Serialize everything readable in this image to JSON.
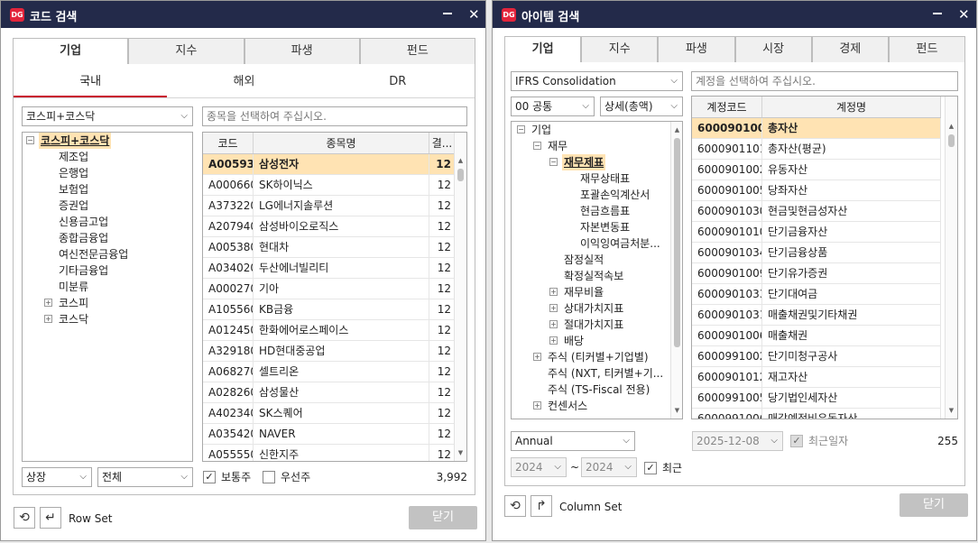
{
  "left": {
    "logo": "DG",
    "title": "코드 검색",
    "tabs": [
      "기업",
      "지수",
      "파생",
      "펀드"
    ],
    "subtabs": [
      "국내",
      "해외",
      "DR"
    ],
    "market_combo": "코스피+코스닥",
    "search_placeholder": "종목을 선택하여 주십시오.",
    "tree": [
      {
        "label": "코스피+코스닥",
        "expander": "−",
        "level": 0,
        "selected": true
      },
      {
        "label": "제조업",
        "level": 1
      },
      {
        "label": "은행업",
        "level": 1
      },
      {
        "label": "보험업",
        "level": 1
      },
      {
        "label": "증권업",
        "level": 1
      },
      {
        "label": "신용금고업",
        "level": 1
      },
      {
        "label": "종합금융업",
        "level": 1
      },
      {
        "label": "여신전문금융업",
        "level": 1
      },
      {
        "label": "기타금융업",
        "level": 1
      },
      {
        "label": "미분류",
        "level": 1
      },
      {
        "label": "코스피",
        "expander": "+",
        "level": 1
      },
      {
        "label": "코스닥",
        "expander": "+",
        "level": 1
      }
    ],
    "grid_headers": [
      "코드",
      "종목명",
      "결..."
    ],
    "rows": [
      [
        "A005930",
        "삼성전자",
        "12"
      ],
      [
        "A000660",
        "SK하이닉스",
        "12"
      ],
      [
        "A373220",
        "LG에너지솔루션",
        "12"
      ],
      [
        "A207940",
        "삼성바이오로직스",
        "12"
      ],
      [
        "A005380",
        "현대차",
        "12"
      ],
      [
        "A034020",
        "두산에너빌리티",
        "12"
      ],
      [
        "A000270",
        "기아",
        "12"
      ],
      [
        "A105560",
        "KB금융",
        "12"
      ],
      [
        "A012450",
        "한화에어로스페이스",
        "12"
      ],
      [
        "A329180",
        "HD현대중공업",
        "12"
      ],
      [
        "A068270",
        "셀트리온",
        "12"
      ],
      [
        "A028260",
        "삼성물산",
        "12"
      ],
      [
        "A402340",
        "SK스퀘어",
        "12"
      ],
      [
        "A035420",
        "NAVER",
        "12"
      ],
      [
        "A055550",
        "신한지주",
        "12"
      ]
    ],
    "status_combo": "상장",
    "all_combo": "전체",
    "common_label": "보통주",
    "preferred_label": "우선주",
    "count": "3,992",
    "row_set_label": "Row Set",
    "close_label": "닫기"
  },
  "right": {
    "logo": "DG",
    "title": "아이템 검색",
    "tabs": [
      "기업",
      "지수",
      "파생",
      "시장",
      "경제",
      "펀드"
    ],
    "consolidation_combo": "IFRS Consolidation",
    "account_placeholder": "계정을 선택하여 주십시오.",
    "common_combo": "00 공통",
    "detail_combo": "상세(총액)",
    "tree": [
      {
        "label": "기업",
        "expander": "−",
        "level": 0
      },
      {
        "label": "재무",
        "expander": "−",
        "level": 1
      },
      {
        "label": "재무제표",
        "expander": "−",
        "level": 2,
        "selected": true
      },
      {
        "label": "재무상태표",
        "level": 3
      },
      {
        "label": "포괄손익계산서",
        "level": 3
      },
      {
        "label": "현금흐름표",
        "level": 3
      },
      {
        "label": "자본변동표",
        "level": 3
      },
      {
        "label": "이익잉여금처분...",
        "level": 3
      },
      {
        "label": "잠정실적",
        "level": 2
      },
      {
        "label": "확정실적속보",
        "level": 2
      },
      {
        "label": "재무비율",
        "expander": "+",
        "level": 2
      },
      {
        "label": "상대가치지표",
        "expander": "+",
        "level": 2
      },
      {
        "label": "절대가치지표",
        "expander": "+",
        "level": 2
      },
      {
        "label": "배당",
        "expander": "+",
        "level": 2
      },
      {
        "label": "주식 (티커별+기업별)",
        "expander": "+",
        "level": 1
      },
      {
        "label": "주식 (NXT, 티커별+기...",
        "level": 1
      },
      {
        "label": "주식 (TS-Fiscal 전용)",
        "level": 1
      },
      {
        "label": "컨센서스",
        "expander": "+",
        "level": 1
      }
    ],
    "grid_headers": [
      "계정코드",
      "계정명"
    ],
    "rows": [
      [
        "6000901001",
        "총자산"
      ],
      [
        "6000901101",
        "총자산(평균)"
      ],
      [
        "6000901002",
        "유동자산"
      ],
      [
        "6000901005",
        "당좌자산"
      ],
      [
        "6000901030",
        "현금및현금성자산"
      ],
      [
        "6000901010",
        "단기금융자산"
      ],
      [
        "6000901034",
        "단기금융상품"
      ],
      [
        "6000901009",
        "단기유가증권"
      ],
      [
        "6000901033",
        "단기대여금"
      ],
      [
        "6000901031",
        "매출채권및기타채권"
      ],
      [
        "6000901006",
        "매출채권"
      ],
      [
        "6000991002",
        "단기미청구공사"
      ],
      [
        "6000901012",
        "재고자산"
      ],
      [
        "6000991005",
        "당기법인세자산"
      ],
      [
        "6000991006",
        "매각예정비유동자산"
      ]
    ],
    "period_combo": "Annual",
    "date_value": "2025-12-08",
    "latest_date_label": "최근일자",
    "count": "255",
    "year_from": "2024",
    "year_sep": "~",
    "year_to": "2024",
    "recent_label": "최근",
    "column_set_label": "Column Set",
    "close_label": "닫기"
  },
  "colors": {
    "titlebar": "#232a4a",
    "logo": "#e3243b",
    "selection": "#ffe3b3",
    "subtab_accent": "#c8102e"
  },
  "icons": {
    "refresh": "refresh-icon",
    "row_set": "row-set-icon",
    "column_set": "column-set-icon",
    "minimize": "minimize-icon",
    "close": "close-icon"
  }
}
